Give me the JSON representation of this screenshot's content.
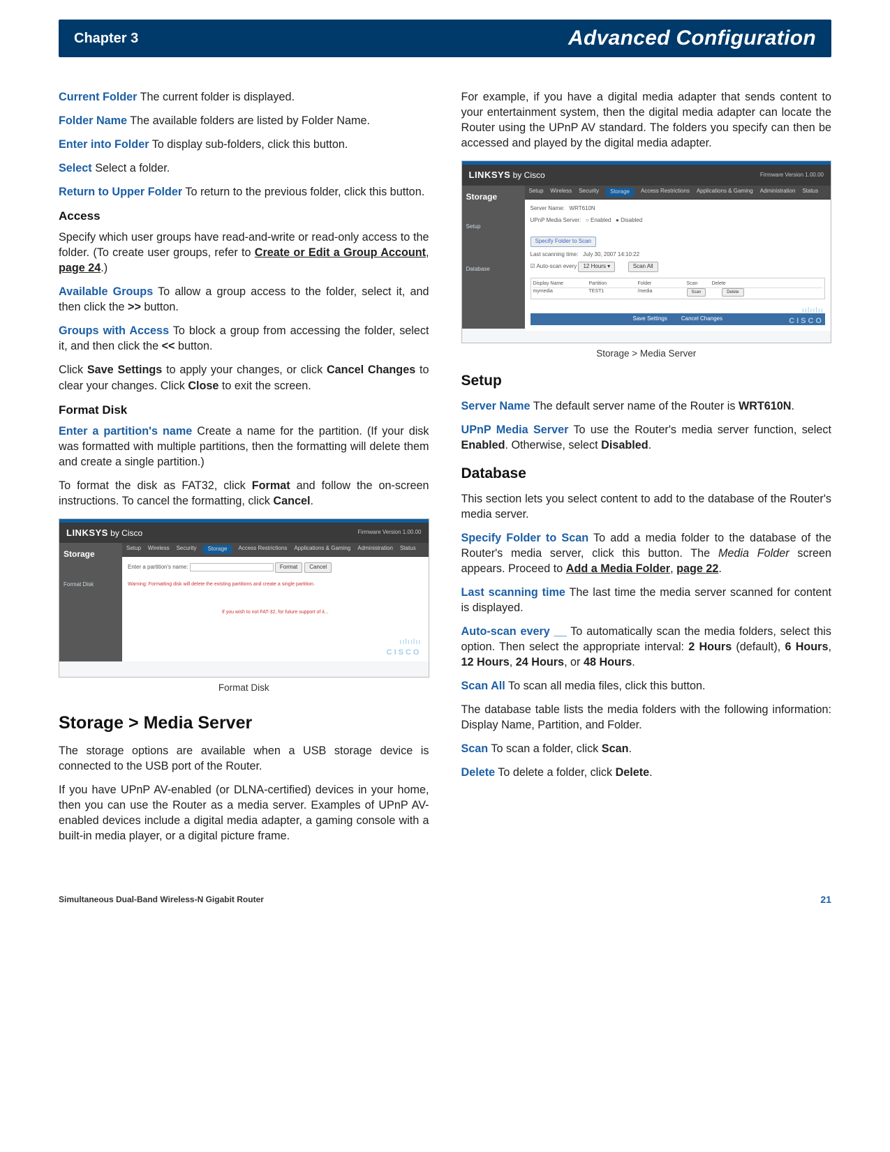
{
  "header": {
    "chapter": "Chapter 3",
    "title": "Advanced Configuration"
  },
  "left": {
    "currentFolder": {
      "term": "Current Folder",
      "text": "  The current folder is displayed."
    },
    "folderName": {
      "term": "Folder Name",
      "text": "  The available folders are listed by Folder Name."
    },
    "enterFolder": {
      "term": "Enter into Folder",
      "text": "  To display sub-folders, click this button."
    },
    "select": {
      "term": "Select",
      "text": "   Select a folder."
    },
    "returnUpper": {
      "term": "Return to Upper Folder",
      "text": "  To return to the previous folder, click this button."
    },
    "accessHeading": "Access",
    "accessPara1a": "Specify which user groups have read-and-write or read-only access to the folder. (To create user groups, refer to ",
    "accessLink1": "Create or Edit a Group Account",
    "accessComma": ", ",
    "accessLink2": "page 24",
    "accessPara1b": ".)",
    "availGroups": {
      "term": "Available Groups",
      "text": "  To allow a group access to the folder, select it, and then click the ",
      "bold": ">>",
      "tail": " button."
    },
    "groupsAccess": {
      "term": "Groups with Access",
      "text": "  To block a group from accessing the folder, select it, and then click the ",
      "bold": "<<",
      "tail": " button."
    },
    "saveCancel1": "Click ",
    "saveCancelB1": "Save Settings",
    "saveCancel2": " to apply your changes, or click ",
    "saveCancelB2": "Cancel Changes",
    "saveCancel3": " to clear your changes. Click ",
    "saveCancelB3": "Close",
    "saveCancel4": " to exit the screen.",
    "formatDiskHeading": "Format Disk",
    "enterPartition": {
      "term": "Enter a partition's name",
      "text": "  Create a name for the partition. (If your disk was formatted with multiple partitions, then the formatting will delete them and create a single partition.)"
    },
    "formatPara1": "To format the disk as FAT32, click ",
    "formatB1": "Format",
    "formatPara2": " and follow the on-screen instructions. To cancel the formatting, click ",
    "formatB2": "Cancel",
    "formatPara3": ".",
    "fig1Caption": "Format Disk",
    "mediaServerHeading": "Storage > Media Server",
    "msPara1": "The storage options are available when a USB storage device is connected to the USB port of the Router.",
    "msPara2": "If you have UPnP AV-enabled (or DLNA-certified) devices in your home, then you can use the Router as a media server. Examples of UPnP AV-enabled devices include a digital media adapter, a gaming console with a built-in media player, or a digital picture frame."
  },
  "right": {
    "topPara": "For example, if you have a digital media adapter that sends content to your entertainment system, then the digital media adapter can locate the Router using the UPnP AV standard. The folders you specify can then be accessed and played by the digital media adapter.",
    "fig2Caption": "Storage > Media Server",
    "setupHeading": "Setup",
    "serverName": {
      "term": "Server Name",
      "text": "  The default server name of the Router is ",
      "bold": "WRT610N",
      "tail": "."
    },
    "upnp": {
      "term": "UPnP Media Server",
      "text": "  To use the Router's media server function, select ",
      "bold1": "Enabled",
      "mid": ". Otherwise, select ",
      "bold2": "Disabled",
      "tail": "."
    },
    "databaseHeading": "Database",
    "dbIntro": "This section lets you select content to add to the database of the Router's media server.",
    "specifyFolder": {
      "term": "Specify Folder to Scan",
      "text": " To add a media folder to the database of the Router's media server, click this button. The ",
      "italic": "Media Folder",
      "mid": " screen appears. Proceed to ",
      "link1": "Add a Media Folder",
      "comma": ", ",
      "link2": "page 22",
      "tail": "."
    },
    "lastScan": {
      "term": "Last scanning time",
      "text": " The last time the media server scanned for content is displayed."
    },
    "autoScan": {
      "term": "Auto-scan every __",
      "text": "  To automatically scan the media folders, select this option. Then select the appropriate interval: ",
      "b1": "2 Hours",
      "m1": " (default), ",
      "b2": "6 Hours",
      "m2": ", ",
      "b3": "12 Hours",
      "m3": ", ",
      "b4": "24 Hours",
      "m4": ", or ",
      "b5": "48 Hours",
      "tail": "."
    },
    "scanAll": {
      "term": "Scan All",
      "text": "  To scan all media files, click this button."
    },
    "dbTable": "The database table lists the media folders with the following information: Display Name, Partition, and Folder.",
    "scan": {
      "term": "Scan",
      "text": "  To scan a folder, click ",
      "bold": "Scan",
      "tail": "."
    },
    "delete": {
      "term": "Delete",
      "text": "  To delete a folder, click ",
      "bold": "Delete",
      "tail": "."
    }
  },
  "figure": {
    "brand": "LINKSYS",
    "by": " by Cisco",
    "sidebarTitle": "Storage",
    "tabs": [
      "Setup",
      "Wireless",
      "Security",
      "Storage",
      "Access Restrictions",
      "Applications & Gaming",
      "Administration",
      "Status"
    ],
    "fig1Side": "Format Disk",
    "fig2SideA": "Setup",
    "fig2SideB": "Database",
    "footSave": "Save Settings",
    "footCancel": "Cancel Changes",
    "ciscoBars": "ıılıılıı",
    "cisco": "CISCO"
  },
  "footer": {
    "product": "Simultaneous Dual-Band Wireless-N Gigabit Router",
    "page": "21"
  }
}
